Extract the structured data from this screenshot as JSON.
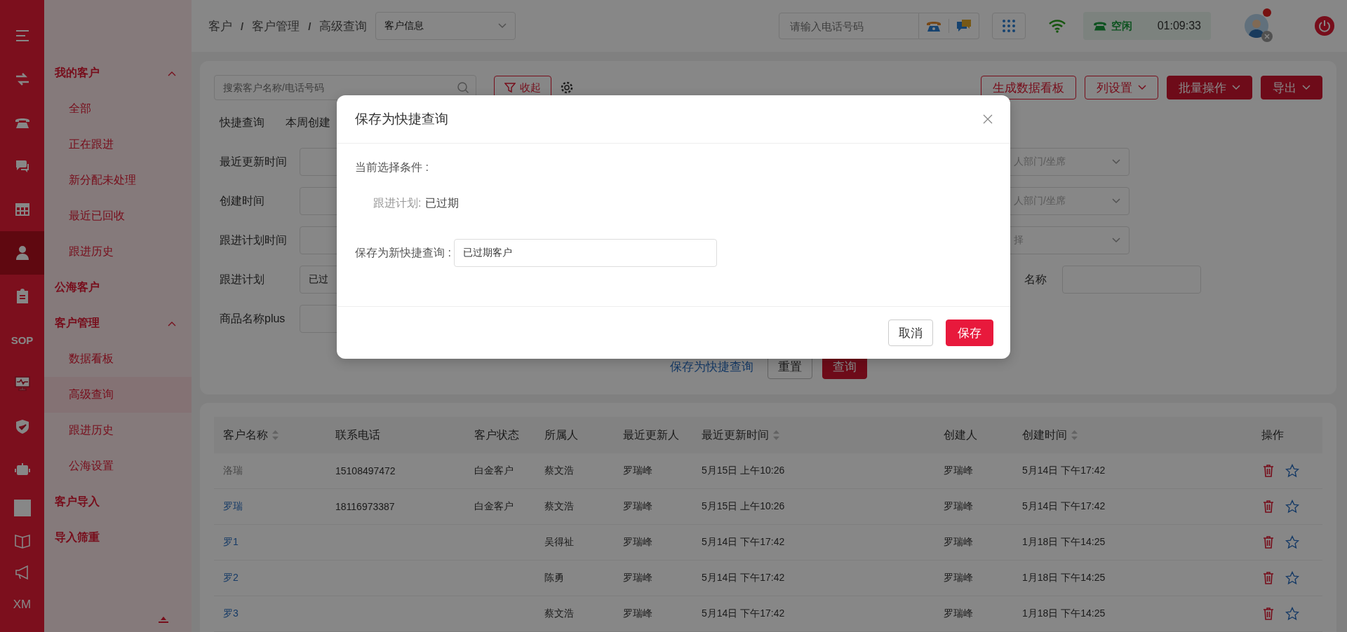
{
  "rail": [
    {
      "selected": false
    },
    {
      "selected": false
    },
    {
      "selected": false
    },
    {
      "selected": false
    },
    {
      "selected": false
    },
    {
      "selected": true
    },
    {
      "selected": false
    },
    {
      "selected": false,
      "label": "SOP"
    },
    {
      "selected": false
    },
    {
      "selected": false
    },
    {
      "selected": false
    },
    {
      "selected": false
    },
    {
      "selected": false
    },
    {
      "selected": false
    },
    {
      "selected": false,
      "label": "XM"
    }
  ],
  "sidebar": {
    "items": [
      {
        "label": "我的客户",
        "expanded": true,
        "children": [
          {
            "label": "全部",
            "selected": false
          },
          {
            "label": "正在跟进",
            "selected": false
          },
          {
            "label": "新分配未处理",
            "selected": false
          },
          {
            "label": "最近已回收",
            "selected": false
          },
          {
            "label": "跟进历史",
            "selected": false
          }
        ]
      },
      {
        "label": "公海客户"
      },
      {
        "label": "客户管理",
        "expanded": true,
        "children": [
          {
            "label": "数据看板",
            "selected": false
          },
          {
            "label": "高级查询",
            "selected": true
          },
          {
            "label": "跟进历史",
            "selected": false
          },
          {
            "label": "公海设置",
            "selected": false
          }
        ]
      },
      {
        "label": "客户导入"
      },
      {
        "label": "导入筛重"
      }
    ]
  },
  "header": {
    "breadcrumb": [
      {
        "kind": "item",
        "text": "客户"
      },
      {
        "kind": "separator",
        "text": "/"
      },
      {
        "kind": "item",
        "text": "客户管理"
      },
      {
        "kind": "separator",
        "text": "/"
      },
      {
        "kind": "item",
        "text": "高级查询"
      }
    ],
    "select": {
      "value": "客户信息"
    },
    "phone_input": {
      "placeholder": "请输入电话号码"
    },
    "status": {
      "label": "空闲",
      "time": "01:09:33"
    }
  },
  "toolbar": {
    "search": {
      "placeholder": "搜索客户名称/电话号码"
    },
    "collapse_button": "收起",
    "buttons": [
      {
        "label": "生成数据看板",
        "kind": "outline"
      },
      {
        "label": "列设置",
        "kind": "outline-dropdown"
      },
      {
        "label": "批量操作",
        "kind": "solid-dropdown"
      },
      {
        "label": "导出",
        "kind": "solid-dropdown"
      }
    ]
  },
  "quick_query": {
    "label": "快捷查询",
    "tags": [
      "本周创建"
    ]
  },
  "filters": [
    {
      "label": "最近更新时间",
      "right": {
        "kind": "select",
        "placeholder": "人部门/坐席"
      }
    },
    {
      "label": "创建时间",
      "right": {
        "kind": "select",
        "placeholder": "人部门/坐席"
      }
    },
    {
      "label": "跟进计划时间",
      "right": {
        "kind": "select",
        "placeholder": "择"
      }
    },
    {
      "label": "跟进计划",
      "value": "已过",
      "right": {
        "kind": "input",
        "label": "名称"
      }
    },
    {
      "label": "商品名称plus"
    }
  ],
  "filter_actions": {
    "save_link": "保存为快捷查询",
    "reset": "重置",
    "query": "查询"
  },
  "table": {
    "columns": [
      {
        "label": "客户名称",
        "sortable": true
      },
      {
        "label": "联系电话",
        "sortable": false
      },
      {
        "label": "客户状态",
        "sortable": false
      },
      {
        "label": "所属人",
        "sortable": false
      },
      {
        "label": "最近更新人",
        "sortable": false
      },
      {
        "label": "最近更新时间",
        "sortable": true
      },
      {
        "label": "创建人",
        "sortable": false
      },
      {
        "label": "创建时间",
        "sortable": true
      },
      {
        "label": "操作",
        "sortable": false
      }
    ],
    "rows": [
      {
        "kind": "text",
        "cells": [
          "洛瑞",
          "15108497472",
          "白金客户",
          "蔡文浩",
          "罗瑞峰",
          "5月15日 上午10:26",
          "罗瑞峰",
          "5月14日 下午17:42"
        ]
      },
      {
        "kind": "link",
        "cells": [
          "罗瑞",
          "18116973387",
          "白金客户",
          "蔡文浩",
          "罗瑞峰",
          "5月15日 上午10:26",
          "罗瑞峰",
          "5月14日 下午17:42"
        ]
      },
      {
        "kind": "link",
        "cells": [
          "罗1",
          "",
          "",
          "吴得祉",
          "罗瑞峰",
          "5月14日 下午17:42",
          "罗瑞峰",
          "1月18日 下午14:25"
        ]
      },
      {
        "kind": "link",
        "cells": [
          "罗2",
          "",
          "",
          "陈勇",
          "罗瑞峰",
          "5月14日 下午17:42",
          "罗瑞峰",
          "1月18日 下午14:25"
        ]
      },
      {
        "kind": "link",
        "cells": [
          "罗3",
          "",
          "",
          "蔡文浩",
          "罗瑞峰",
          "5月14日 下午17:42",
          "罗瑞峰",
          "1月18日 下午14:25"
        ]
      }
    ]
  },
  "dialog": {
    "title": "保存为快捷查询",
    "conditions_label": "当前选择条件 :",
    "conditions": [
      {
        "key": "跟进计划:",
        "value": "已过期"
      }
    ],
    "name_label": "保存为新快捷查询 :",
    "name_value": "已过期客户",
    "cancel": "取消",
    "save": "保存"
  }
}
